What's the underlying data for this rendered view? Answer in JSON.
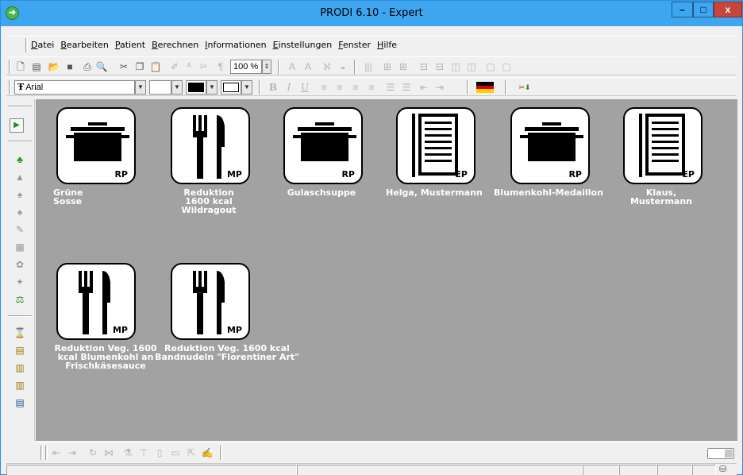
{
  "window": {
    "title": "PRODI 6.10 - Expert",
    "min_label": "–",
    "max_label": "□",
    "close_label": "x"
  },
  "menu": [
    "Datei",
    "Bearbeiten",
    "Patient",
    "Berechnen",
    "Informationen",
    "Einstellungen",
    "Fenster",
    "Hilfe"
  ],
  "toolbar": {
    "zoom_value": "100 %",
    "font_name": "Arial"
  },
  "tiles": [
    {
      "icon": "pot-icon",
      "code": "RP",
      "label": "Grüne\nSosse"
    },
    {
      "icon": "cutlery-icon",
      "code": "MP",
      "label": "Reduktion\n1600 kcal\nWildragout"
    },
    {
      "icon": "pot-icon",
      "code": "RP",
      "label": "Gulaschsuppe"
    },
    {
      "icon": "document-icon",
      "code": "EP",
      "label": "Helga, Mustermann"
    },
    {
      "icon": "pot-icon",
      "code": "RP",
      "label": "Blumenkohl-Medaillon"
    },
    {
      "icon": "document-icon",
      "code": "EP",
      "label": "Klaus,\nMustermann"
    },
    {
      "icon": "cutlery-icon",
      "code": "MP",
      "label": "Reduktion Veg. 1600\nkcal Blumenkohl an\nFrischkäsesauce"
    },
    {
      "icon": "cutlery-icon",
      "code": "MP",
      "label": "Reduktion Veg. 1600 kcal\nBandnudeln \"Florentiner Art\""
    }
  ],
  "colors": {
    "titlebar": "#3ea5f0",
    "workspace": "#a2a2a2",
    "close": "#c7463a"
  }
}
